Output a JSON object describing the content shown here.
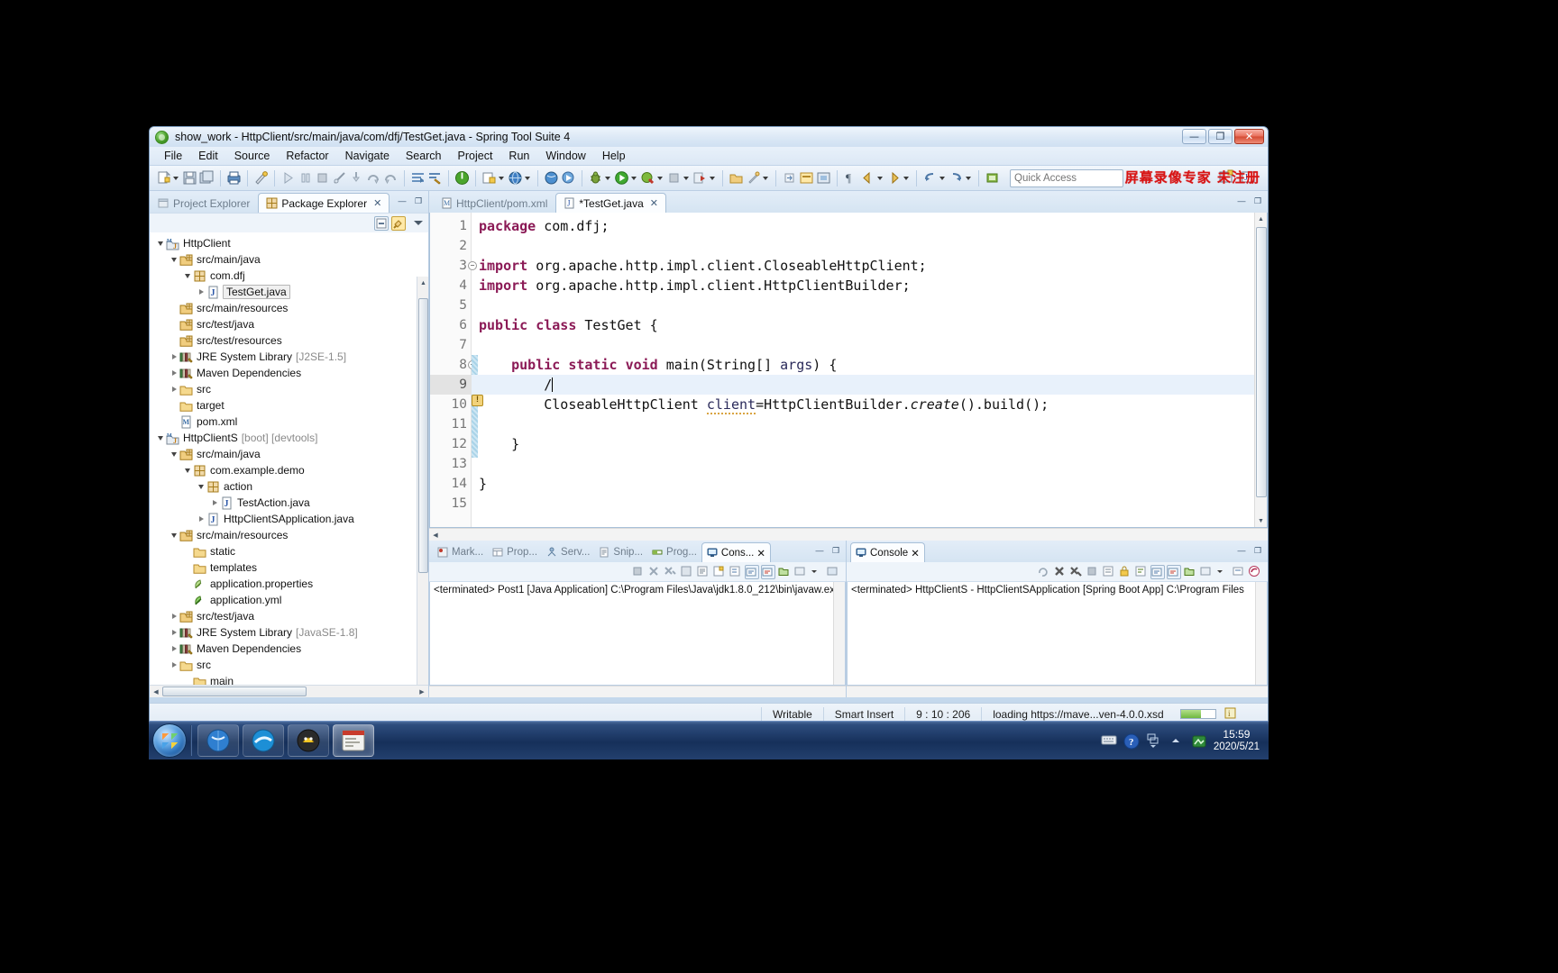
{
  "window": {
    "title": "show_work - HttpClient/src/main/java/com/dfj/TestGet.java - Spring Tool Suite 4",
    "minimize_label": "—",
    "maximize_label": "❐",
    "close_label": "✕"
  },
  "menu": {
    "items": [
      "File",
      "Edit",
      "Source",
      "Refactor",
      "Navigate",
      "Search",
      "Project",
      "Run",
      "Window",
      "Help"
    ]
  },
  "toolbar": {
    "watermark": "屏幕录像专家 未注册",
    "quick_access_placeholder": "Quick Access"
  },
  "explorer": {
    "tabs": [
      {
        "label": "Project Explorer",
        "icon": "project-explorer-icon",
        "active": false,
        "closable": false
      },
      {
        "label": "Package Explorer",
        "icon": "package-explorer-icon",
        "active": true,
        "closable": true
      }
    ],
    "close_glyph": "✕",
    "minimize_glyph": "—",
    "maximize_glyph": "❐",
    "tree": [
      {
        "indent": 0,
        "twisty": "open",
        "icon": "java-project-icon",
        "label": "HttpClient",
        "dim": "",
        "selected": false
      },
      {
        "indent": 1,
        "twisty": "open",
        "icon": "source-folder-icon",
        "label": "src/main/java",
        "dim": "",
        "selected": false
      },
      {
        "indent": 2,
        "twisty": "open",
        "icon": "package-icon",
        "label": "com.dfj",
        "dim": "",
        "selected": false
      },
      {
        "indent": 3,
        "twisty": "closed",
        "icon": "java-file-icon",
        "label": "TestGet.java",
        "dim": "",
        "selected": true
      },
      {
        "indent": 1,
        "twisty": "none",
        "icon": "source-folder-icon",
        "label": "src/main/resources",
        "dim": "",
        "selected": false
      },
      {
        "indent": 1,
        "twisty": "none",
        "icon": "source-folder-icon",
        "label": "src/test/java",
        "dim": "",
        "selected": false
      },
      {
        "indent": 1,
        "twisty": "none",
        "icon": "source-folder-icon",
        "label": "src/test/resources",
        "dim": "",
        "selected": false
      },
      {
        "indent": 1,
        "twisty": "closed",
        "icon": "library-icon",
        "label": "JRE System Library",
        "dim": "[J2SE-1.5]",
        "selected": false
      },
      {
        "indent": 1,
        "twisty": "closed",
        "icon": "library-icon",
        "label": "Maven Dependencies",
        "dim": "",
        "selected": false
      },
      {
        "indent": 1,
        "twisty": "closed",
        "icon": "folder-icon",
        "label": "src",
        "dim": "",
        "selected": false
      },
      {
        "indent": 1,
        "twisty": "none",
        "icon": "folder-icon",
        "label": "target",
        "dim": "",
        "selected": false
      },
      {
        "indent": 1,
        "twisty": "none",
        "icon": "xml-file-icon",
        "label": "pom.xml",
        "dim": "",
        "selected": false
      },
      {
        "indent": 0,
        "twisty": "open",
        "icon": "java-project-icon",
        "label": "HttpClientS",
        "dim": "[boot] [devtools]",
        "selected": false
      },
      {
        "indent": 1,
        "twisty": "open",
        "icon": "source-folder-icon",
        "label": "src/main/java",
        "dim": "",
        "selected": false
      },
      {
        "indent": 2,
        "twisty": "open",
        "icon": "package-icon",
        "label": "com.example.demo",
        "dim": "",
        "selected": false
      },
      {
        "indent": 3,
        "twisty": "open",
        "icon": "package-icon",
        "label": "action",
        "dim": "",
        "selected": false
      },
      {
        "indent": 4,
        "twisty": "closed",
        "icon": "java-file-icon",
        "label": "TestAction.java",
        "dim": "",
        "selected": false
      },
      {
        "indent": 3,
        "twisty": "closed",
        "icon": "java-file-icon",
        "label": "HttpClientSApplication.java",
        "dim": "",
        "selected": false
      },
      {
        "indent": 1,
        "twisty": "open",
        "icon": "source-folder-icon",
        "label": "src/main/resources",
        "dim": "",
        "selected": false
      },
      {
        "indent": 2,
        "twisty": "none",
        "icon": "folder-icon",
        "label": "static",
        "dim": "",
        "selected": false
      },
      {
        "indent": 2,
        "twisty": "none",
        "icon": "folder-icon",
        "label": "templates",
        "dim": "",
        "selected": false
      },
      {
        "indent": 2,
        "twisty": "none",
        "icon": "properties-file-icon",
        "label": "application.properties",
        "dim": "",
        "selected": false
      },
      {
        "indent": 2,
        "twisty": "none",
        "icon": "yml-file-icon",
        "label": "application.yml",
        "dim": "",
        "selected": false
      },
      {
        "indent": 1,
        "twisty": "closed",
        "icon": "source-folder-icon",
        "label": "src/test/java",
        "dim": "",
        "selected": false
      },
      {
        "indent": 1,
        "twisty": "closed",
        "icon": "library-icon",
        "label": "JRE System Library",
        "dim": "[JavaSE-1.8]",
        "selected": false
      },
      {
        "indent": 1,
        "twisty": "closed",
        "icon": "library-icon",
        "label": "Maven Dependencies",
        "dim": "",
        "selected": false
      },
      {
        "indent": 1,
        "twisty": "closed",
        "icon": "folder-icon",
        "label": "src",
        "dim": "",
        "selected": false
      },
      {
        "indent": 2,
        "twisty": "none",
        "icon": "folder-icon",
        "label": "main",
        "dim": "",
        "selected": false
      }
    ]
  },
  "editor": {
    "tabs": [
      {
        "label": "HttpClient/pom.xml",
        "icon": "xml-file-icon",
        "active": false,
        "dirty": false
      },
      {
        "label": "*TestGet.java",
        "icon": "java-file-icon",
        "active": true,
        "dirty": true
      }
    ],
    "close_glyph": "✕",
    "lines": [
      {
        "n": "1",
        "fold": "",
        "current": false,
        "html": "<span class=\"kw\">package</span> com.dfj;"
      },
      {
        "n": "2",
        "fold": "",
        "current": false,
        "html": ""
      },
      {
        "n": "3",
        "fold": "−",
        "current": false,
        "html": "<span class=\"kw\">import</span> org.apache.http.impl.client.CloseableHttpClient;"
      },
      {
        "n": "4",
        "fold": "",
        "current": false,
        "html": "<span class=\"kw\">import</span> org.apache.http.impl.client.HttpClientBuilder;"
      },
      {
        "n": "5",
        "fold": "",
        "current": false,
        "html": ""
      },
      {
        "n": "6",
        "fold": "",
        "current": false,
        "html": "<span class=\"kw\">public</span> <span class=\"kw\">class</span> TestGet {"
      },
      {
        "n": "7",
        "fold": "",
        "current": false,
        "html": ""
      },
      {
        "n": "8",
        "fold": "−",
        "current": false,
        "html": "    <span class=\"kw\">public</span> <span class=\"kw\">static</span> <span class=\"kw\">void</span> main(String[] <span class=\"fld\">args</span>) {"
      },
      {
        "n": "9",
        "fold": "",
        "current": true,
        "html": "        /<span class=\"caret\"></span>"
      },
      {
        "n": "10",
        "fold": "",
        "current": false,
        "html": "        CloseableHttpClient <span class=\"fld sq-under\">client</span>=HttpClientBuilder.<span class=\"it\">create</span>().build();"
      },
      {
        "n": "11",
        "fold": "",
        "current": false,
        "html": ""
      },
      {
        "n": "12",
        "fold": "",
        "current": false,
        "html": "    }"
      },
      {
        "n": "13",
        "fold": "",
        "current": false,
        "html": ""
      },
      {
        "n": "14",
        "fold": "",
        "current": false,
        "html": "}"
      },
      {
        "n": "15",
        "fold": "",
        "current": false,
        "html": ""
      }
    ],
    "source_text": "package com.dfj;\n\nimport org.apache.http.impl.client.CloseableHttpClient;\nimport org.apache.http.impl.client.HttpClientBuilder;\n\npublic class TestGet {\n\n    public static void main(String[] args) {\n        /\n        CloseableHttpClient client=HttpClientBuilder.create().build();\n\n    }\n\n}\n"
  },
  "console_left": {
    "tabs": [
      {
        "label": "Mark...",
        "icon": "markers-icon",
        "active": false
      },
      {
        "label": "Prop...",
        "icon": "properties-icon",
        "active": false
      },
      {
        "label": "Serv...",
        "icon": "servers-icon",
        "active": false
      },
      {
        "label": "Snip...",
        "icon": "snippets-icon",
        "active": false
      },
      {
        "label": "Prog...",
        "icon": "progress-icon",
        "active": false
      },
      {
        "label": "Cons...",
        "icon": "console-icon",
        "active": true
      }
    ],
    "close_glyph": "✕",
    "minimize_glyph": "—",
    "maximize_glyph": "❐",
    "body_text": "<terminated> Post1 [Java Application] C:\\Program Files\\Java\\jdk1.8.0_212\\bin\\javaw.ex"
  },
  "console_right": {
    "tabs": [
      {
        "label": "Console",
        "icon": "console-icon",
        "active": true
      }
    ],
    "close_glyph": "✕",
    "minimize_glyph": "—",
    "maximize_glyph": "❐",
    "body_text": "<terminated> HttpClientS - HttpClientSApplication [Spring Boot App] C:\\Program Files"
  },
  "statusbar": {
    "writable": "Writable",
    "insert_mode": "Smart Insert",
    "position": "9 : 10 : 206",
    "progress_text": "loading https://mave...ven-4.0.0.xsd"
  },
  "taskbar": {
    "apps": [
      {
        "name": "browser-app",
        "active": false
      },
      {
        "name": "browser2-app",
        "active": false
      },
      {
        "name": "tomcat-app",
        "active": false
      },
      {
        "name": "sts-app",
        "active": true
      }
    ],
    "tray_icons": [
      "keyboard-icon",
      "help-icon",
      "show-desktop-icon",
      "show-hidden-icons-icon",
      "network-icon"
    ],
    "clock_time": "15:59",
    "clock_date": "2020/5/21"
  },
  "colors": {
    "accent": "#2d4d7e",
    "keyword": "#8b1a56",
    "watermark": "#d81414",
    "selection": "#e8f1fb"
  }
}
